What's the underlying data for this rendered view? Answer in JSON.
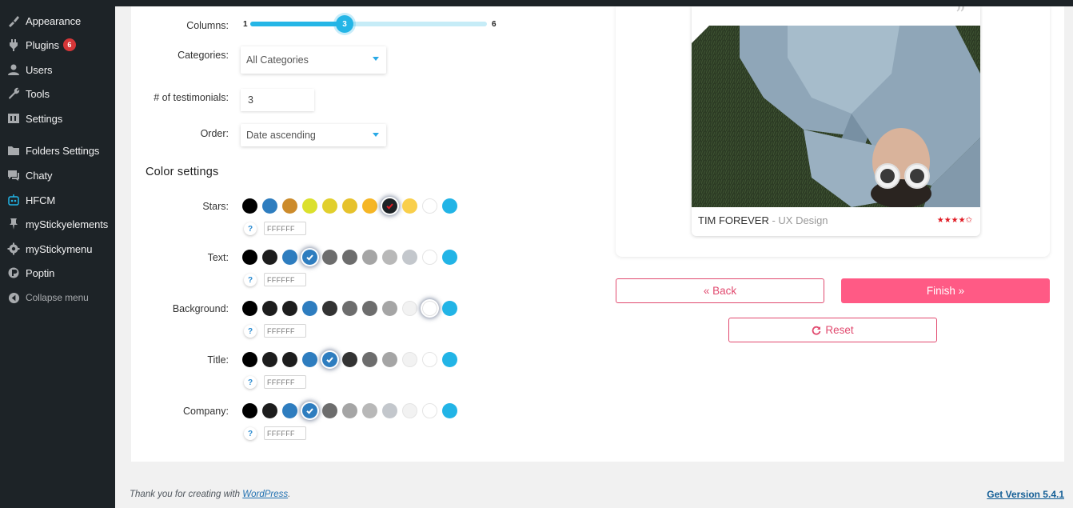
{
  "sidebar": {
    "items": [
      {
        "label": "Appearance",
        "icon": "brush-icon"
      },
      {
        "label": "Plugins",
        "icon": "plugin-icon",
        "badge": "6"
      },
      {
        "label": "Users",
        "icon": "user-icon"
      },
      {
        "label": "Tools",
        "icon": "wrench-icon"
      },
      {
        "label": "Settings",
        "icon": "settings-icon"
      },
      {
        "label": "Folders Settings",
        "icon": "folder-icon"
      },
      {
        "label": "Chaty",
        "icon": "chat-icon"
      },
      {
        "label": "HFCM",
        "icon": "robot-icon"
      },
      {
        "label": "myStickyelements",
        "icon": "pin-icon"
      },
      {
        "label": "myStickymenu",
        "icon": "gear-icon"
      },
      {
        "label": "Poptin",
        "icon": "poptin-icon"
      },
      {
        "label": "Collapse menu",
        "icon": "collapse-icon"
      }
    ]
  },
  "form": {
    "columns": {
      "label": "Columns:",
      "value": "3",
      "min": "1",
      "max": "6",
      "fraction": 0.4
    },
    "categories": {
      "label": "Categories:",
      "value": "All Categories"
    },
    "testimonials": {
      "label": "# of testimonials:",
      "value": "3"
    },
    "order": {
      "label": "Order:",
      "value": "Date ascending"
    }
  },
  "color_settings": {
    "title": "Color settings",
    "rows": [
      {
        "label": "Stars:",
        "hex": "FFFFFF",
        "swatches": [
          "#000000",
          "#2e7dbf",
          "#cc8b2b",
          "#dbe02d",
          "#e1cf2d",
          "#e6c22c",
          "#f5b625",
          "#1d2327",
          "#f9cf4b",
          "#ffffff",
          "#22b4e6"
        ],
        "selected": 7
      },
      {
        "label": "Text:",
        "hex": "FFFFFF",
        "swatches": [
          "#000000",
          "#1d1d1d",
          "#2e7dbf",
          "#2e7dbf",
          "#6d6d6d",
          "#6d6d6d",
          "#a5a5a5",
          "#b8b8b8",
          "#c3c7cc",
          "#ffffff",
          "#22b4e6"
        ],
        "selected": 3
      },
      {
        "label": "Background:",
        "hex": "FFFFFF",
        "swatches": [
          "#000000",
          "#1d1d1d",
          "#1d1d1d",
          "#2e7dbf",
          "#333333",
          "#6d6d6d",
          "#6d6d6d",
          "#a5a5a5",
          "#f2f2f2",
          "#ffffff",
          "#22b4e6"
        ],
        "selected": 9
      },
      {
        "label": "Title:",
        "hex": "FFFFFF",
        "swatches": [
          "#000000",
          "#1d1d1d",
          "#1d1d1d",
          "#2e7dbf",
          "#2e7dbf",
          "#333333",
          "#6d6d6d",
          "#a5a5a5",
          "#f2f2f2",
          "#ffffff",
          "#22b4e6"
        ],
        "selected": 4
      },
      {
        "label": "Company:",
        "hex": "FFFFFF",
        "swatches": [
          "#000000",
          "#1d1d1d",
          "#2e7dbf",
          "#2e7dbf",
          "#6d6d6d",
          "#a5a5a5",
          "#b8b8b8",
          "#c3c7cc",
          "#f2f2f2",
          "#ffffff",
          "#22b4e6"
        ],
        "selected": 3
      }
    ]
  },
  "preview": {
    "name": "TIM FOREVER",
    "company": " - UX Design",
    "stars": "★★★★✩",
    "rating": 4.5
  },
  "buttons": {
    "back": "« Back",
    "finish": "Finish »",
    "reset": "Reset"
  },
  "footer": {
    "thanks_prefix": "Thank you for creating with ",
    "link": "WordPress",
    "suffix": ".",
    "version": "Get Version 5.4.1"
  },
  "colors": {
    "accent_pink": "#ff5a85",
    "accent_blue": "#22b4e6",
    "sidebar_bg": "#1d2327"
  }
}
